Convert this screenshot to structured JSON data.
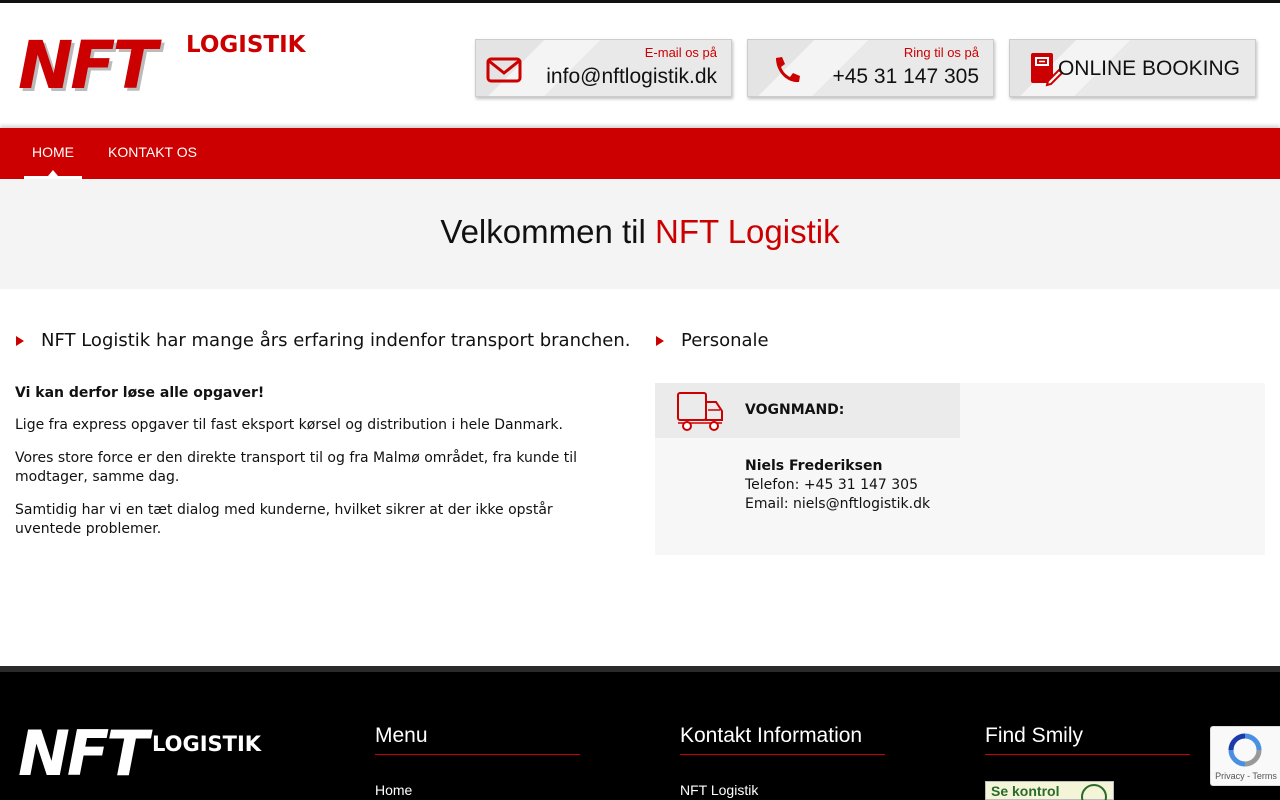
{
  "header": {
    "logo_main": "NFT",
    "logo_sub": "LOGISTIK",
    "email_label": "E-mail os på",
    "email_value": "info@nftlogistik.dk",
    "phone_label": "Ring til os på",
    "phone_value": "+45 31 147 305",
    "booking_label": "ONLINE BOOKING"
  },
  "nav": {
    "items": [
      {
        "label": "HOME",
        "active": true
      },
      {
        "label": "KONTAKT OS",
        "active": false
      }
    ]
  },
  "hero": {
    "title_plain": "Velkommen til",
    "title_accent": "NFT Logistik"
  },
  "left": {
    "heading": "NFT Logistik har mange års erfaring indenfor transport branchen.",
    "paragraphs": [
      "Vi kan derfor løse alle opgaver!",
      "Lige fra express opgaver til fast eksport kørsel og distribution i hele Danmark.",
      "Vores store force er den direkte transport til og fra Malmø området, fra kunde til modtager, samme dag.",
      "Samtidig har vi en tæt dialog med kunderne, hvilket sikrer at der ikke opstår uventede problemer."
    ]
  },
  "right": {
    "heading": "Personale",
    "staff": {
      "role": "VOGNMAND:",
      "name": "Niels Frederiksen",
      "phone": "Telefon: +45 31 147 305",
      "email": "Email: niels@nftlogistik.dk"
    }
  },
  "footer": {
    "logo_main": "NFT",
    "logo_sub": "LOGISTIK",
    "col1_title": "Menu",
    "col1_link": "Home",
    "col2_title": "Kontakt Information",
    "col2_link": "NFT Logistik",
    "col3_title": "Find Smily",
    "smiley_text": "Se kontrol"
  },
  "recaptcha": {
    "links": "Privacy - Terms"
  },
  "colors": {
    "brand_red": "#cc0000",
    "footer_bg": "#000000",
    "hero_bg": "#f4f4f4"
  },
  "icons": [
    "mail-icon",
    "phone-icon",
    "booking-icon",
    "truck-icon",
    "recaptcha-icon"
  ]
}
